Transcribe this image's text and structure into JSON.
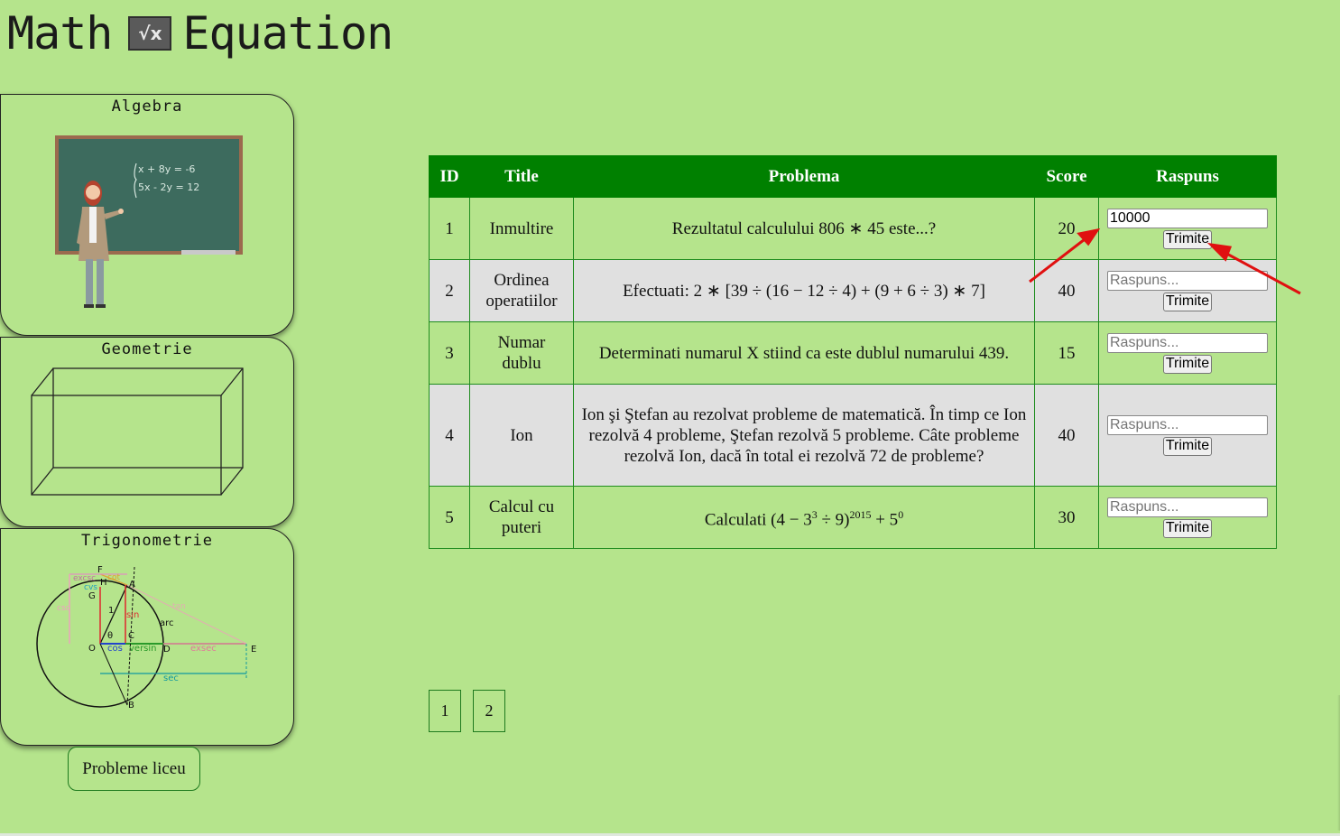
{
  "logo": {
    "word_left": "Math",
    "mark": "√x",
    "word_right": "Equation"
  },
  "sidebar": {
    "cards": [
      {
        "title": "Algebra",
        "board": {
          "line1": "x + 8y = -6",
          "line2": "5x - 2y = 12"
        }
      },
      {
        "title": "Geometrie"
      },
      {
        "title": "Trigonometrie",
        "labels": [
          "F",
          "H",
          "A",
          "G",
          "1",
          "sin",
          "arc",
          "O",
          "θ",
          "C",
          "cos",
          "versin",
          "D",
          "exsec",
          "E",
          "sec",
          "B",
          "excsc",
          "cvs",
          "cot",
          "tan",
          "csc"
        ]
      }
    ],
    "liceu_button": "Probleme liceu"
  },
  "table": {
    "headers": [
      "ID",
      "Title",
      "Problema",
      "Score",
      "Raspuns"
    ],
    "submit_label": "Trimite",
    "placeholder": "Raspuns...",
    "rows": [
      {
        "id": "1",
        "title": "Inmultire",
        "problem": "Rezultatul calculului 806 ∗ 45 este...?",
        "score": "20",
        "answer": "10000"
      },
      {
        "id": "2",
        "title": "Ordinea operatiilor",
        "problem": "Efectuati: 2 ∗ [39 ÷ (16 − 12 ÷ 4) + (9 + 6 ÷ 3) ∗ 7]",
        "score": "40",
        "answer": ""
      },
      {
        "id": "3",
        "title": "Numar dublu",
        "problem": "Determinati numarul X stiind ca este dublul numarului 439.",
        "score": "15",
        "answer": ""
      },
      {
        "id": "4",
        "title": "Ion",
        "problem": "Ion şi Ştefan au rezolvat probleme de matematică. În timp ce Ion rezolvă 4 probleme, Ştefan rezolvă 5 probleme. Câte probleme rezolvă Ion, dacă în total ei rezolvă 72 de probleme?",
        "score": "40",
        "answer": ""
      },
      {
        "id": "5",
        "title": "Calcul cu puteri",
        "problem_parts": {
          "prefix": "Calculati (4 − 3",
          "exp1": "3",
          "mid": " ÷ 9)",
          "exp2": "2015",
          "plus": " + 5",
          "exp3": "0"
        },
        "score": "30",
        "answer": ""
      }
    ]
  },
  "pagination": [
    "1",
    "2"
  ],
  "colors": {
    "background": "#b5e48c",
    "header": "#008000",
    "row_alt": "#e0e0e0",
    "arrow": "#e01010"
  }
}
